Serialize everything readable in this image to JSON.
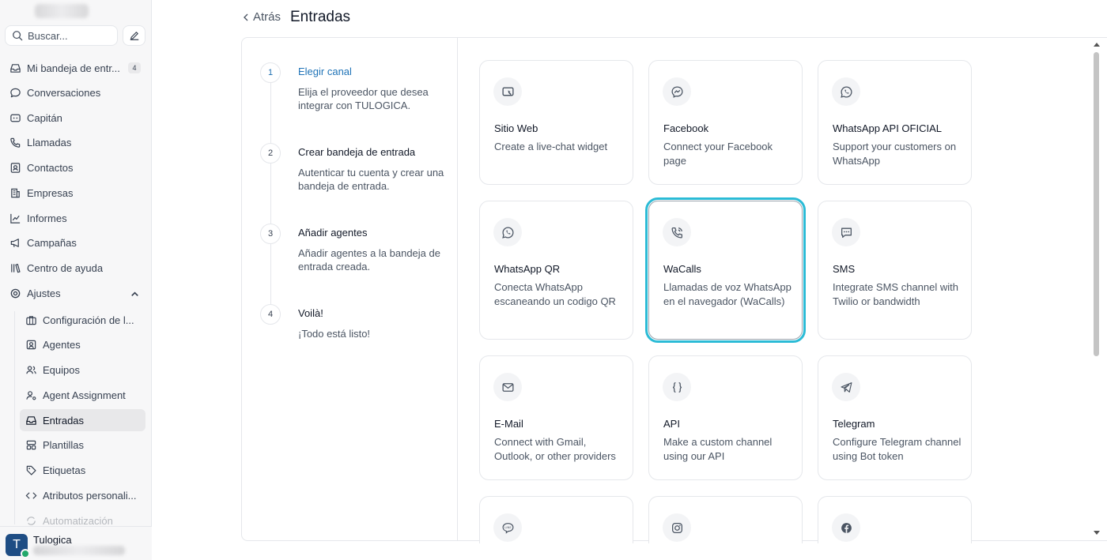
{
  "sidebar": {
    "search_placeholder": "Buscar...",
    "items": [
      {
        "label": "Mi bandeja de entr...",
        "icon": "inbox-icon",
        "badge": "4"
      },
      {
        "label": "Conversaciones",
        "icon": "chat-bubble-icon"
      },
      {
        "label": "Capitán",
        "icon": "captain-icon"
      },
      {
        "label": "Llamadas",
        "icon": "phone-icon"
      },
      {
        "label": "Contactos",
        "icon": "contact-card-icon"
      },
      {
        "label": "Empresas",
        "icon": "building-icon"
      },
      {
        "label": "Informes",
        "icon": "chart-line-icon"
      },
      {
        "label": "Campañas",
        "icon": "megaphone-icon"
      },
      {
        "label": "Centro de ayuda",
        "icon": "library-icon"
      },
      {
        "label": "Ajustes",
        "icon": "settings-icon"
      }
    ],
    "sub_items": [
      {
        "label": "Configuración de l...",
        "icon": "briefcase-icon"
      },
      {
        "label": "Agentes",
        "icon": "agent-icon"
      },
      {
        "label": "Equipos",
        "icon": "team-icon"
      },
      {
        "label": "Agent Assignment",
        "icon": "user-cog-icon"
      },
      {
        "label": "Entradas",
        "icon": "inbox-icon"
      },
      {
        "label": "Plantillas",
        "icon": "template-icon"
      },
      {
        "label": "Etiquetas",
        "icon": "tag-icon"
      },
      {
        "label": "Atributos personali...",
        "icon": "code-icon"
      },
      {
        "label": "Automatización",
        "icon": "automation-icon"
      }
    ],
    "user": {
      "initial": "T",
      "name": "Tulogica"
    }
  },
  "header": {
    "back_label": "Atrás",
    "title": "Entradas"
  },
  "steps": [
    {
      "number": "1",
      "title": "Elegir canal",
      "description": "Elija el proveedor que desea integrar con TULOGICA."
    },
    {
      "number": "2",
      "title": "Crear bandeja de entrada",
      "description": "Autenticar tu cuenta y crear una bandeja de entrada."
    },
    {
      "number": "3",
      "title": "Añadir agentes",
      "description": "Añadir agentes a la bandeja de entrada creada."
    },
    {
      "number": "4",
      "title": "Voilà!",
      "description": "¡Todo está listo!"
    }
  ],
  "channels": [
    {
      "title": "Sitio Web",
      "description": "Create a live-chat widget",
      "icon": "web-widget-icon"
    },
    {
      "title": "Facebook",
      "description": "Connect your Facebook page",
      "icon": "messenger-icon"
    },
    {
      "title": "WhatsApp API OFICIAL",
      "description": "Support your customers on WhatsApp",
      "icon": "whatsapp-icon"
    },
    {
      "title": "WhatsApp QR",
      "description": "Conecta WhatsApp escaneando un codigo QR",
      "icon": "whatsapp-icon"
    },
    {
      "title": "WaCalls",
      "description": "Llamadas de voz WhatsApp en el navegador (WaCalls)",
      "icon": "phone-call-icon"
    },
    {
      "title": "SMS",
      "description": "Integrate SMS channel with Twilio or bandwidth",
      "icon": "sms-icon"
    },
    {
      "title": "E-Mail",
      "description": "Connect with Gmail, Outlook, or other providers",
      "icon": "mail-icon"
    },
    {
      "title": "API",
      "description": "Make a custom channel using our API",
      "icon": "braces-icon"
    },
    {
      "title": "Telegram",
      "description": "Configure Telegram channel using Bot token",
      "icon": "telegram-icon"
    },
    {
      "title": "",
      "description": "",
      "icon": "line-icon"
    },
    {
      "title": "",
      "description": "",
      "icon": "instagram-icon"
    },
    {
      "title": "",
      "description": "",
      "icon": "facebook-icon"
    }
  ],
  "colors": {
    "accent": "#1f73b7",
    "selected_outline": "#2bbbd6",
    "avatar": "#1e4d84",
    "online": "#22a86b"
  }
}
